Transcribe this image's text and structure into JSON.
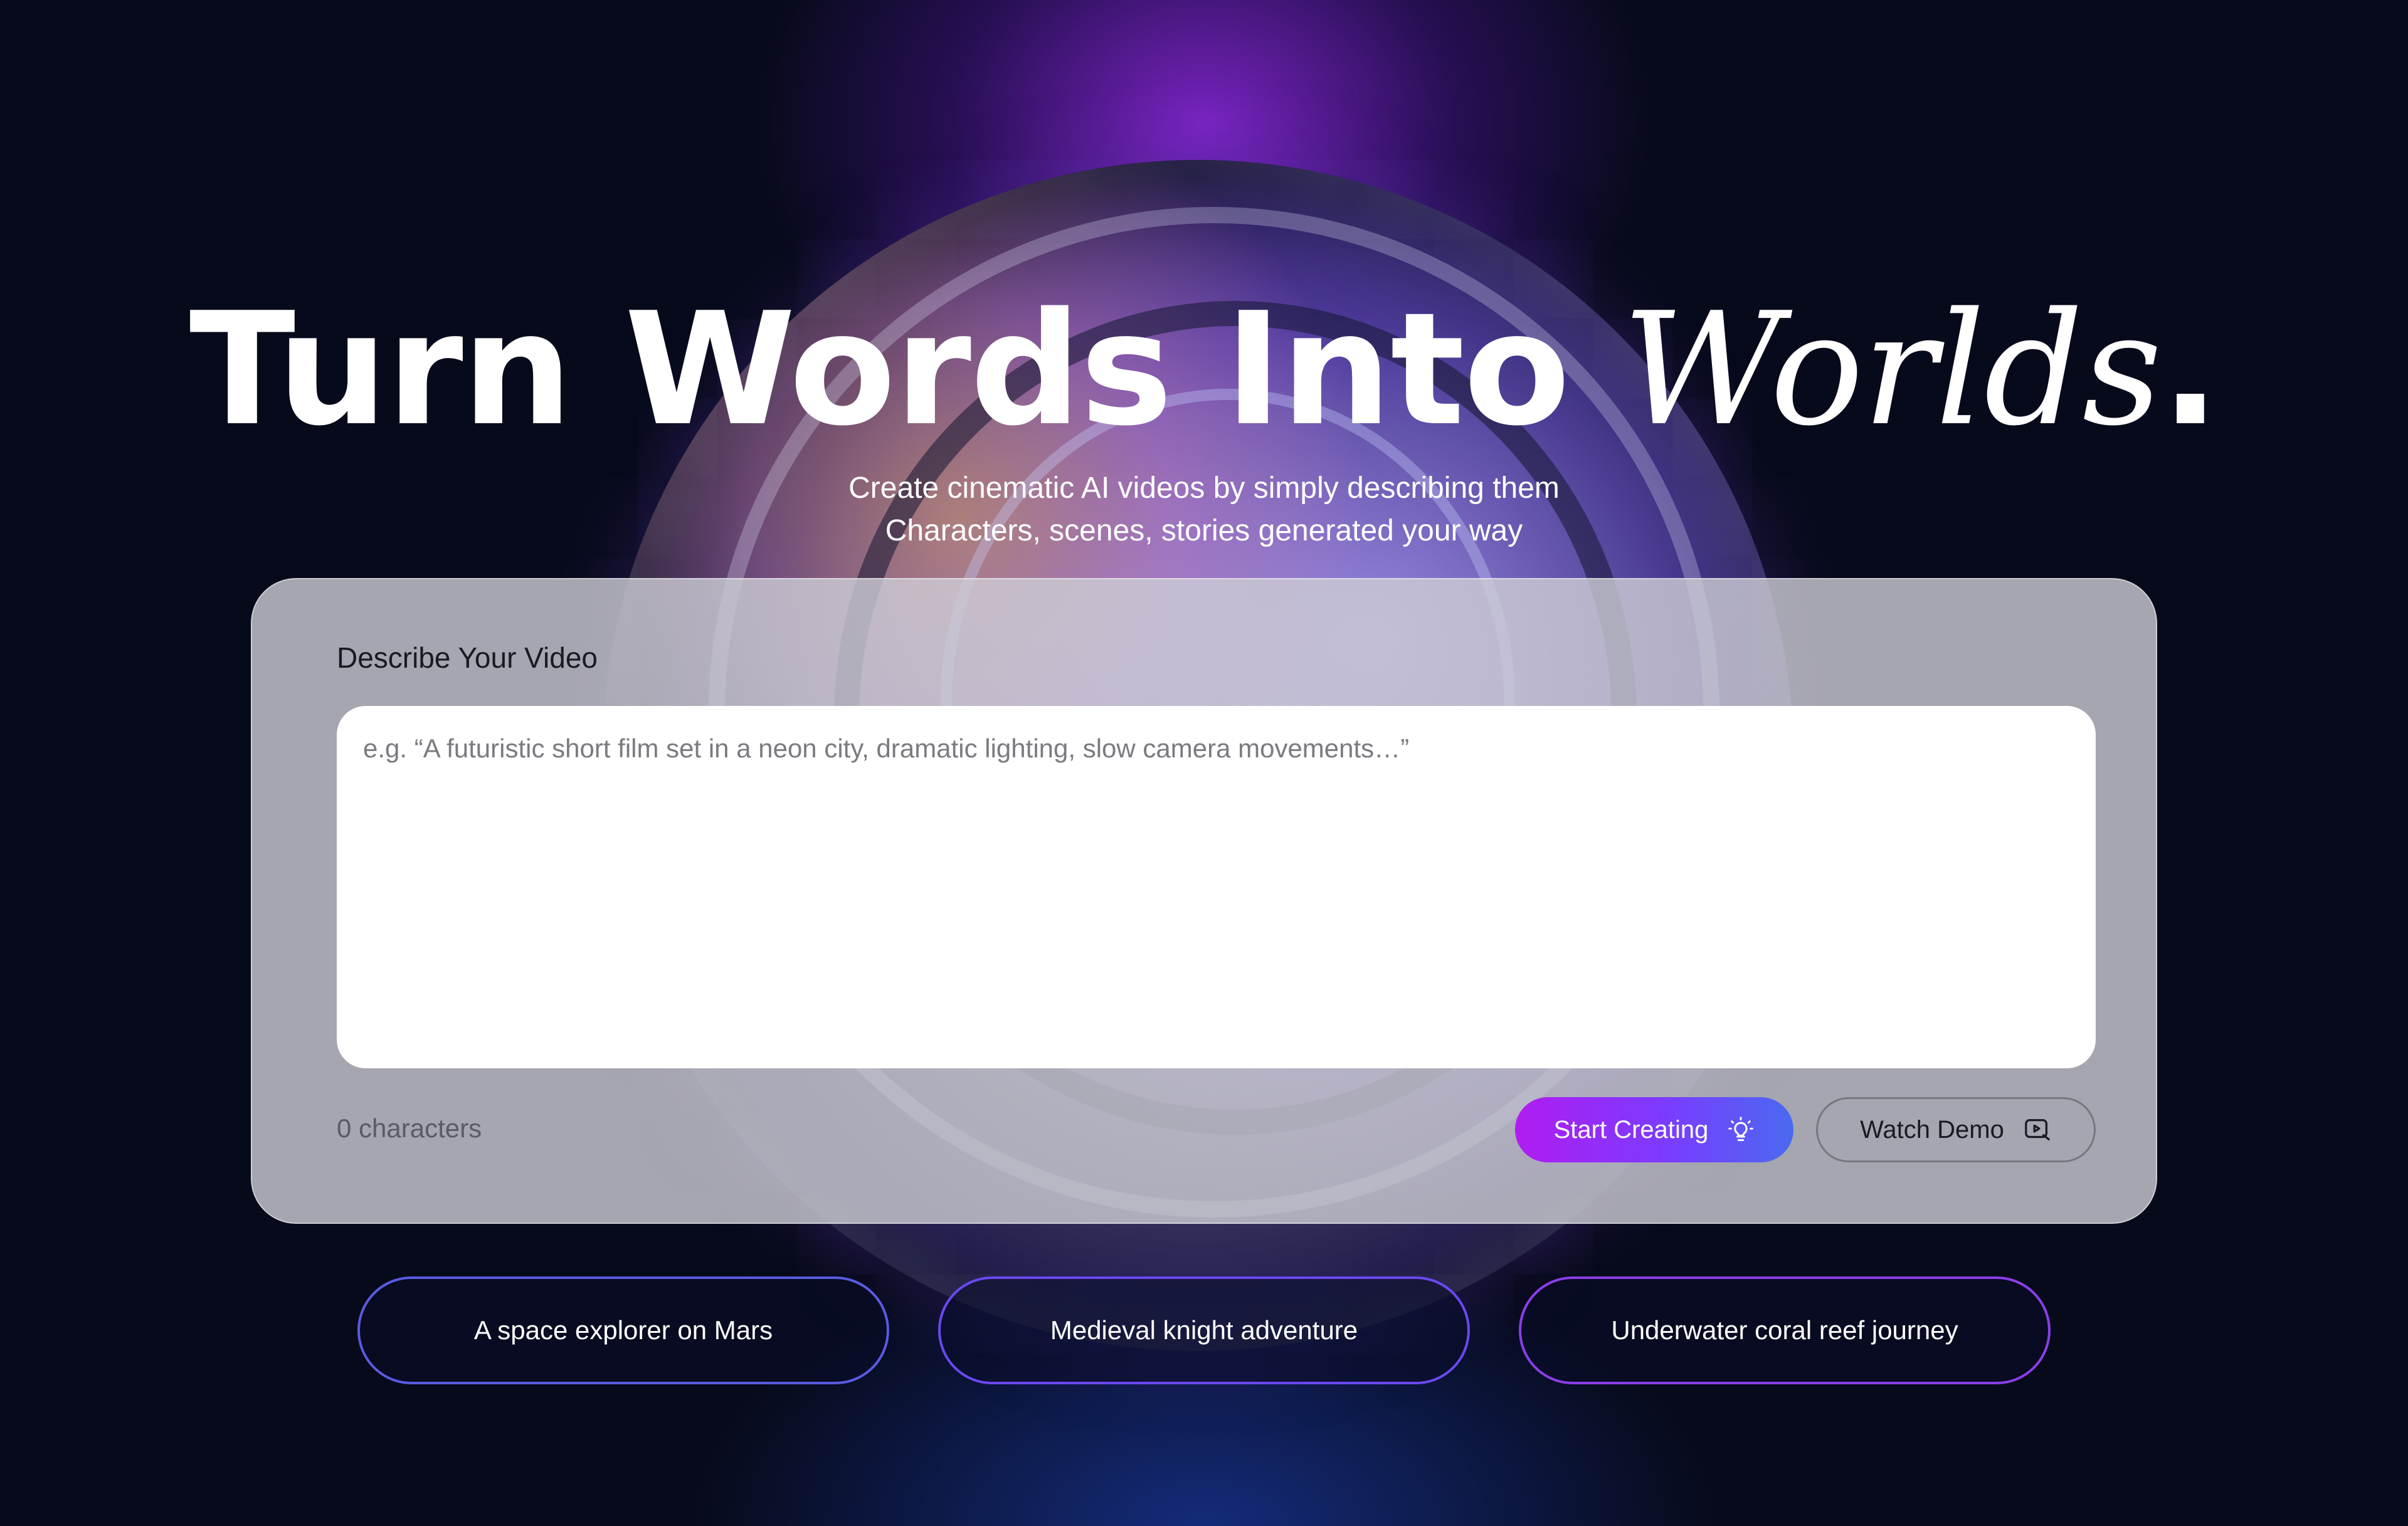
{
  "hero": {
    "headline_main": "Turn Words Into ",
    "headline_accent": "Worlds",
    "headline_end": ".",
    "subtitle_line1": "Create cinematic AI videos by simply describing them",
    "subtitle_line2": "Characters, scenes, stories  generated your way"
  },
  "panel": {
    "label": "Describe Your Video",
    "prompt_value": "",
    "prompt_placeholder": "e.g. “A futuristic short film set in a neon city, dramatic lighting, slow camera movements…”",
    "char_count": "0 characters",
    "start_label": "Start Creating",
    "start_icon": "lightbulb-icon",
    "demo_label": "Watch Demo",
    "demo_icon": "play-video-icon"
  },
  "suggestions": [
    {
      "label": "A space explorer on Mars"
    },
    {
      "label": "Medieval knight adventure"
    },
    {
      "label": "Underwater coral reef journey"
    }
  ],
  "colors": {
    "background": "#070a1a",
    "accent_purple": "#b01cf0",
    "accent_blue": "#4a6af0",
    "panel": "#cdcdd4"
  }
}
